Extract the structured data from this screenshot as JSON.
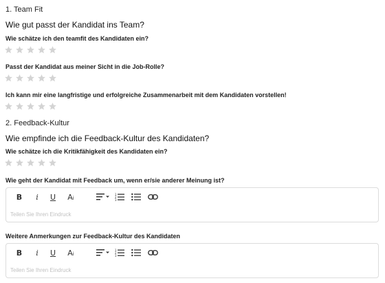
{
  "sections": [
    {
      "title": "1. Team Fit",
      "subtitle": "Wie gut passt der Kandidat ins Team?",
      "questions": [
        {
          "label": "Wie schätze ich den teamfit des Kandidaten ein?",
          "rating": 0,
          "max": 5
        },
        {
          "label": "Passt der Kandidat aus meiner Sicht in die Job-Rolle?",
          "rating": 0,
          "max": 5
        },
        {
          "label": "Ich kann mir eine langfristige und erfolgreiche Zusammenarbeit mit dem Kandidaten vorstellen!",
          "rating": 0,
          "max": 5
        }
      ]
    },
    {
      "title": "2. Feedback-Kultur",
      "subtitle": "Wie empfinde ich die Feedback-Kultur des Kandidaten?",
      "questions": [
        {
          "label": "Wie schätze ich die Kritikfähigkeit des Kandidaten ein?",
          "rating": 0,
          "max": 5
        }
      ],
      "editors": [
        {
          "label": "Wie geht der Kandidat mit Feedback um, wenn er/sie anderer Meinung ist?",
          "placeholder": "Teilen Sie Ihren Eindruck"
        },
        {
          "label": "Weitere Anmerkungen zur Feedback-Kultur des Kandidaten",
          "placeholder": "Teilen Sie Ihren Eindruck"
        }
      ]
    }
  ],
  "toolbar": {
    "bold_label": "B",
    "italic_label": "i",
    "underline_label": "U",
    "textsize_label": "A",
    "textsize_sub": "i",
    "icons": [
      "bold-icon",
      "italic-icon",
      "underline-icon",
      "text-size-icon",
      "align-dropdown-icon",
      "ordered-list-icon",
      "bullet-list-icon",
      "link-icon"
    ]
  },
  "colors": {
    "star_empty": "#d4d4d4",
    "editor_border": "#dcdcdc",
    "placeholder": "#c2c2c2"
  }
}
